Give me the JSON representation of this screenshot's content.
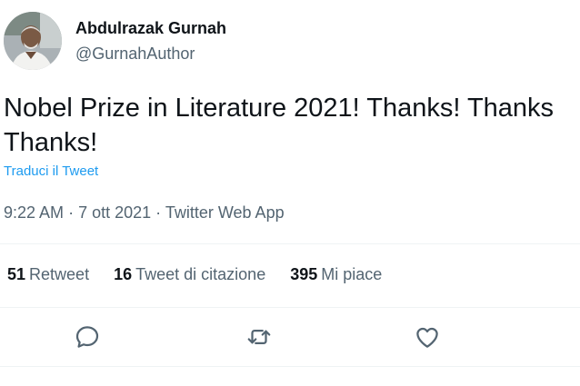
{
  "author": {
    "name": "Abdulrazak Gurnah",
    "handle": "@GurnahAuthor"
  },
  "tweet": {
    "line1": "Nobel Prize in Literature 2021! Thanks! Thanks",
    "line2": "Thanks!",
    "translate_label": "Traduci il Tweet"
  },
  "meta": {
    "time": "9:22 AM",
    "date": "7 ott 2021",
    "source": "Twitter Web App",
    "separator": "·"
  },
  "stats": [
    {
      "count": "51",
      "label": "Retweet"
    },
    {
      "count": "16",
      "label": "Tweet di citazione"
    },
    {
      "count": "395",
      "label": "Mi piace"
    }
  ],
  "actions": [
    "reply-icon",
    "retweet-icon",
    "like-icon"
  ],
  "colors": {
    "link_blue": "#1d9bf0",
    "secondary_text": "#536471",
    "primary_text": "#0f1419",
    "divider": "#eff3f4"
  }
}
